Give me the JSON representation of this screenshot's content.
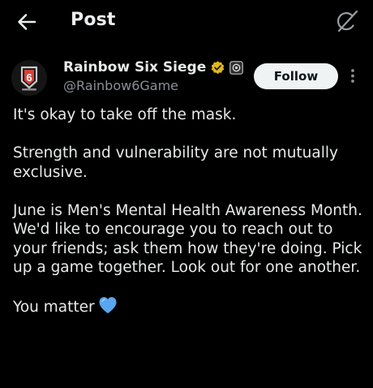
{
  "header": {
    "title": "Post",
    "back_icon": "arrow-left-icon",
    "grok_icon": "grok-icon"
  },
  "author": {
    "display_name": "Rainbow Six Siege",
    "handle": "@Rainbow6Game",
    "avatar_text": "6",
    "verified_icon": "verified-gold-badge-icon",
    "affiliate_icon": "affiliate-badge-icon"
  },
  "actions": {
    "follow_label": "Follow",
    "more_icon": "more-vertical-icon"
  },
  "post": {
    "paragraphs": [
      "It's okay to take off the mask.",
      "Strength and vulnerability are not mutually exclusive.",
      "June is Men's Mental Health Awareness Month. We'd like to encourage you to reach out to your friends; ask them how they're doing. Pick up a game together. Look out for one another.",
      "You matter"
    ],
    "emoji": "blue-heart-icon"
  },
  "colors": {
    "background": "#000000",
    "text": "#e7e9ea",
    "secondary_text": "#8b9096",
    "follow_bg": "#eff3f4",
    "verified_gold": "#e2b719",
    "heart_blue": "#5aa6ee",
    "avatar_red": "#d8423a"
  }
}
